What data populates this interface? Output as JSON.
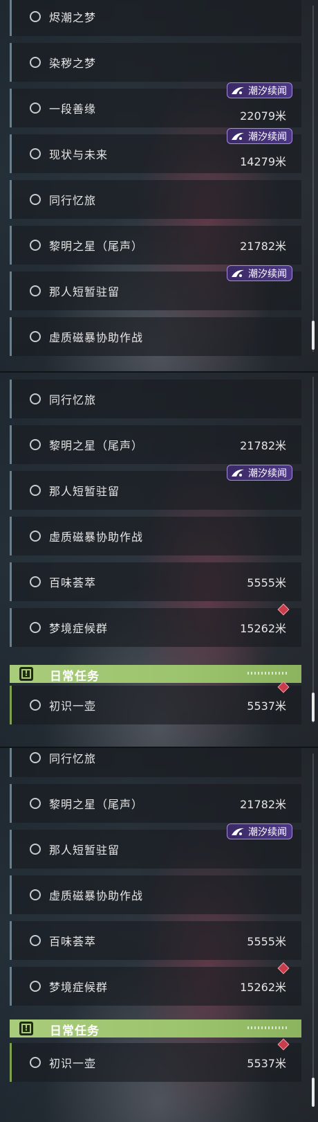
{
  "badge_label": "潮汐续闻",
  "distance_unit": "米",
  "section_daily": {
    "title": "日常任务"
  },
  "panels": [
    {
      "items": [
        {
          "label": "烬潮之梦"
        },
        {
          "label": "染秽之梦"
        },
        {
          "label": "一段善缘",
          "distance": "22079米",
          "badge": "潮汐续闻"
        },
        {
          "label": "现状与未来",
          "distance": "14279米",
          "badge": "潮汐续闻"
        },
        {
          "label": "同行忆旅"
        },
        {
          "label": "黎明之星（尾声）",
          "distance": "21782米"
        },
        {
          "label": "那人短暂驻留",
          "badge": "潮汐续闻"
        },
        {
          "label": "虚质磁暴协助作战"
        }
      ]
    },
    {
      "items": [
        {
          "label": "同行忆旅"
        },
        {
          "label": "黎明之星（尾声）",
          "distance": "21782米"
        },
        {
          "label": "那人短暂驻留",
          "badge": "潮汐续闻"
        },
        {
          "label": "虚质磁暴协助作战"
        },
        {
          "label": "百味荟萃",
          "distance": "5555米"
        },
        {
          "label": "梦境症候群",
          "distance": "15262米"
        }
      ],
      "daily_items": [
        {
          "label": "初识一壶",
          "distance": "5537米"
        }
      ]
    },
    {
      "items": [
        {
          "label": "同行忆旅"
        },
        {
          "label": "黎明之星（尾声）",
          "distance": "21782米"
        },
        {
          "label": "那人短暂驻留",
          "badge": "潮汐续闻"
        },
        {
          "label": "虚质磁暴协助作战"
        },
        {
          "label": "百味荟萃",
          "distance": "5555米"
        },
        {
          "label": "梦境症候群",
          "distance": "15262米"
        }
      ],
      "daily_items": [
        {
          "label": "初识一壶",
          "distance": "5537米"
        }
      ]
    }
  ],
  "colors": {
    "badge_border": "#a98be0",
    "badge_bg": "#4b3785",
    "section_bg": "#a9cc7b",
    "diamond": "#c83c4c",
    "row_accent": "#6a7e8c",
    "daily_accent": "#7fa24f"
  }
}
